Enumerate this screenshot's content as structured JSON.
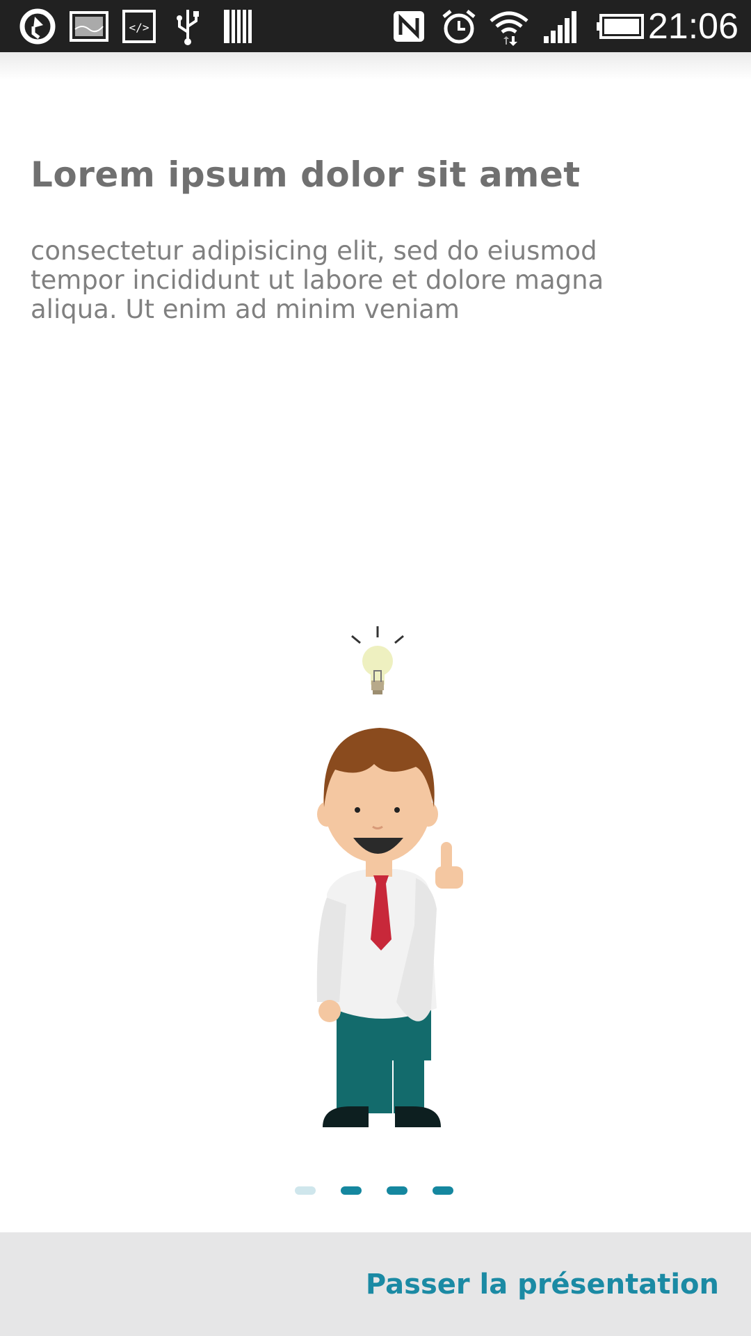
{
  "status_bar": {
    "time": "21:06",
    "left_icons": [
      "sync-icon",
      "image-icon",
      "code-icon",
      "usb-icon",
      "storage-icon"
    ],
    "right_icons": [
      "nfc-icon",
      "alarm-icon",
      "wifi-icon",
      "signal-icon",
      "battery-icon"
    ]
  },
  "intro": {
    "title": "Lorem ipsum dolor sit amet",
    "body": "consectetur adipisicing elit, sed do eiusmod tempor incididunt ut labore et dolore magna aliqua. Ut enim ad minim veniam"
  },
  "pager": {
    "count": 4,
    "active_color": "#15879f",
    "inactive_color": "#cfe6ec"
  },
  "footer": {
    "skip_label": "Passer la présentation"
  },
  "colors": {
    "accent": "#1b8aa4",
    "status_bar": "#212121",
    "footer_bg": "#e6e6e7"
  }
}
